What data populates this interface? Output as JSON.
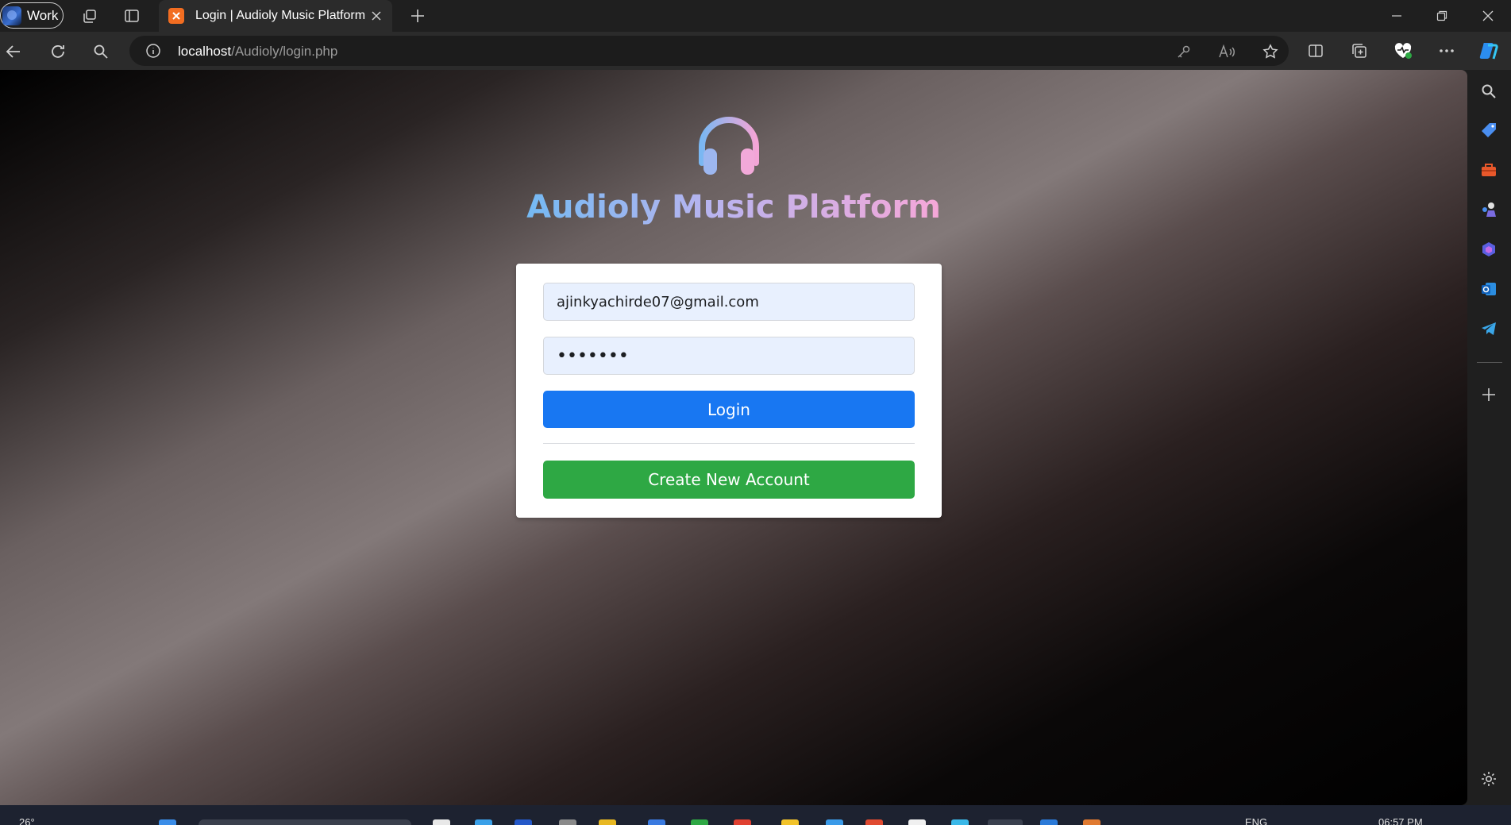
{
  "browser": {
    "profile_label": "Work",
    "tab_title": "Login | Audioly Music Platform",
    "url_host": "localhost",
    "url_path": "/Audioly/login.php"
  },
  "page": {
    "brand_title": "Audioly Music Platform",
    "email_value": "ajinkyachirde07@gmail.com",
    "password_value": "•••••••",
    "login_label": "Login",
    "create_account_label": "Create New Account"
  },
  "taskbar": {
    "weather": "26°",
    "language": "ENG",
    "time": "06:57 PM"
  },
  "colors": {
    "brand_gradient_start": "#74b9f3",
    "brand_gradient_end": "#f6a7d8",
    "login_button": "#1877f2",
    "create_button": "#2ea844",
    "input_background": "#e8f0fe"
  },
  "icons": {
    "logo": "headphones-icon",
    "toolbar": [
      "back-icon",
      "refresh-icon",
      "search-icon",
      "info-icon",
      "key-icon",
      "read-aloud-icon",
      "favorite-star-icon",
      "split-screen-icon",
      "collections-icon",
      "browser-essentials-icon",
      "more-icon",
      "copilot-icon"
    ],
    "sidebar": [
      "search-icon",
      "shopping-tag-icon",
      "tools-icon",
      "games-icon",
      "copilot-sidebar-icon",
      "outlook-icon",
      "telegram-icon",
      "add-icon",
      "settings-icon"
    ]
  }
}
